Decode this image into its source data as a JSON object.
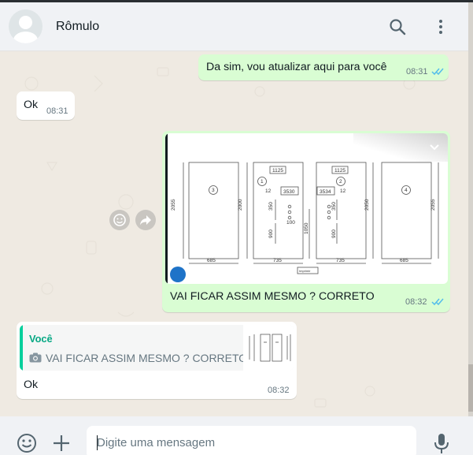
{
  "header": {
    "contact_name": "Rômulo",
    "icons": [
      "default-avatar-icon",
      "search-icon",
      "menu-dots-icon"
    ]
  },
  "messages": [
    {
      "direction": "out",
      "text": "Da sim, vou atualizar aqui para você",
      "time": "08:31",
      "status": "read"
    },
    {
      "direction": "in",
      "text": "Ok",
      "time": "08:31"
    },
    {
      "direction": "out",
      "type": "image",
      "caption": "VAI FICAR ASSIM MESMO ? CORRETO",
      "time": "08:32",
      "status": "read",
      "drawing": {
        "labels": [
          "1125",
          "1125",
          "3530",
          "3534",
          "12",
          "12",
          "350",
          "350",
          "100",
          "1050",
          "900",
          "900",
          "2055",
          "2000",
          "2050",
          "2055",
          "685",
          "735",
          "735",
          "685",
          "Imprimir"
        ],
        "circle_numbers": [
          "3",
          "1",
          "2",
          "4"
        ]
      }
    },
    {
      "direction": "in",
      "type": "reply",
      "quoted_author": "Você",
      "quoted_text": "VAI FICAR ASSIM MESMO ? CORRETO",
      "text": "Ok",
      "time": "08:32"
    }
  ],
  "footer": {
    "placeholder": "Digite uma mensagem",
    "icons": [
      "emoji-icon",
      "plus-icon",
      "microphone-icon"
    ]
  },
  "colors": {
    "outgoing_bubble": "#d9fdd3",
    "incoming_bubble": "#ffffff",
    "read_ticks": "#53bdeb",
    "chat_background": "#efeae2",
    "header_background": "#f0f2f5",
    "quote_accent": "#06cf9c"
  }
}
